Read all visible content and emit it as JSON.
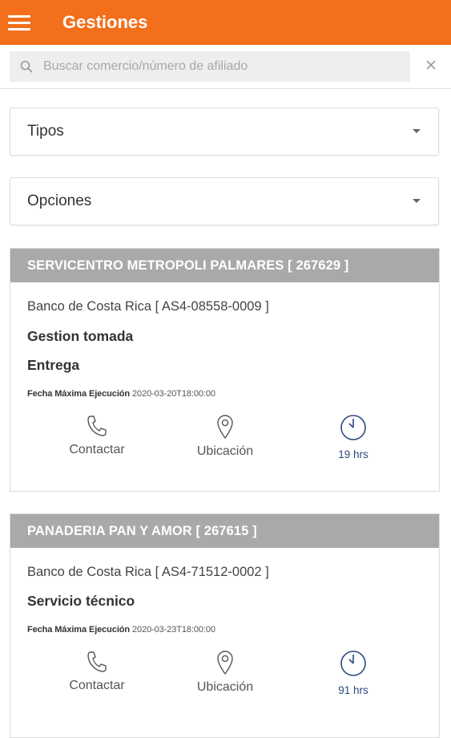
{
  "header": {
    "title": "Gestiones",
    "menu_icon": "hamburger-menu-icon"
  },
  "search": {
    "placeholder": "Buscar comercio/número de afiliado",
    "value": ""
  },
  "filters": {
    "tipos_label": "Tipos",
    "opciones_label": "Opciones"
  },
  "colors": {
    "brand": "#f36f1c",
    "card_header": "#a9a9a9",
    "timer": "#2c4a7c"
  },
  "cards": [
    {
      "title": "SERVICENTRO METROPOLI PALMARES [ 267629 ]",
      "bank": "Banco de Costa Rica [ AS4-08558-0009 ]",
      "status_lines": [
        "Gestion tomada",
        "Entrega"
      ],
      "fecha_label": "Fecha Máxima Ejecución",
      "fecha_value": "2020-03-20T18:00:00",
      "actions": {
        "contact": "Contactar",
        "location": "Ubicación",
        "timer": "19 hrs"
      }
    },
    {
      "title": "PANADERIA PAN Y AMOR [ 267615 ]",
      "bank": "Banco de Costa Rica [ AS4-71512-0002 ]",
      "status_lines": [
        "Servicio técnico"
      ],
      "fecha_label": "Fecha Máxima Ejecución",
      "fecha_value": "2020-03-23T18:00:00",
      "actions": {
        "contact": "Contactar",
        "location": "Ubicación",
        "timer": "91 hrs"
      }
    }
  ]
}
